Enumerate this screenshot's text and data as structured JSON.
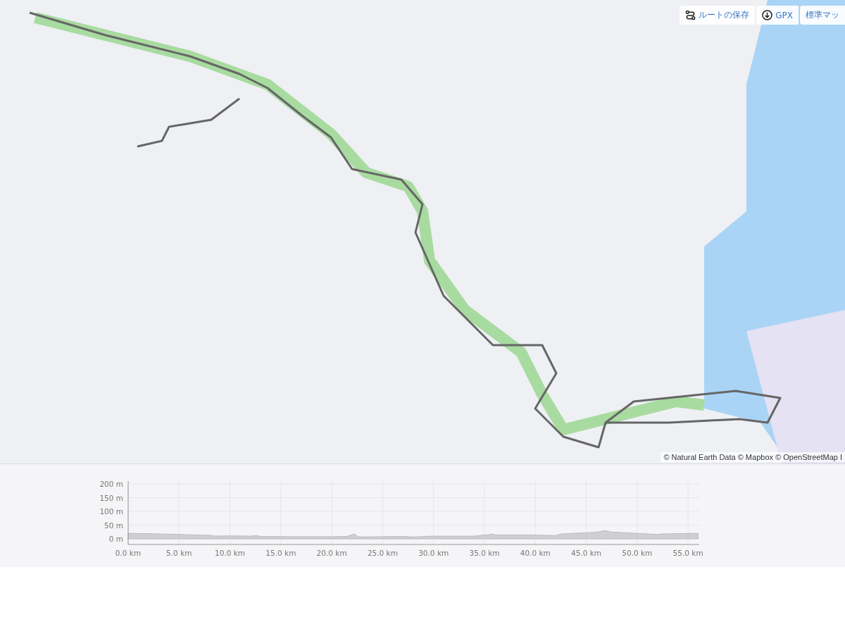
{
  "map": {
    "buttons": [
      {
        "kind": "route",
        "label": "ルートの保存"
      },
      {
        "kind": "download",
        "label": "GPX"
      },
      {
        "kind": "plain",
        "label": "標準マッ"
      }
    ],
    "attribution": "© Natural Earth Data © Mapbox © OpenStreetMap I"
  },
  "elevation": {
    "chart_data": {
      "type": "area",
      "x": [
        0,
        2,
        4,
        6,
        8,
        8.5,
        10,
        12,
        12.6,
        13,
        16,
        20,
        21.5,
        22.2,
        22.6,
        25,
        27,
        28,
        30,
        34,
        35.3,
        35.9,
        36,
        40,
        42,
        42.5,
        46,
        46.8,
        47.5,
        50,
        52,
        52.5,
        54,
        56
      ],
      "series": [
        {
          "color": "#cfcfd2",
          "values": [
            20,
            19,
            17,
            15,
            13,
            10,
            11,
            10,
            12,
            9,
            8,
            8,
            9,
            18,
            7,
            8,
            9,
            7,
            10,
            10,
            15,
            18,
            14,
            14,
            12,
            18,
            24,
            30,
            25,
            20,
            16,
            18,
            19,
            20
          ]
        }
      ],
      "ylim": [
        0,
        210
      ],
      "grid": true,
      "xlim": [
        0,
        56.1
      ],
      "xticks": [
        {
          "value": 0,
          "label": "0.0 km"
        },
        {
          "value": 5,
          "label": "5.0 km"
        },
        {
          "value": 10,
          "label": "10.0 km"
        },
        {
          "value": 15,
          "label": "15.0 km"
        },
        {
          "value": 20,
          "label": "20.0 km"
        },
        {
          "value": 25,
          "label": "25.0 km"
        },
        {
          "value": 30,
          "label": "30.0 km"
        },
        {
          "value": 35,
          "label": "35.0 km"
        },
        {
          "value": 40,
          "label": "40.0 km"
        },
        {
          "value": 45,
          "label": "45.0 km"
        },
        {
          "value": 50,
          "label": "50.0 km"
        },
        {
          "value": 55,
          "label": "55.0 km"
        }
      ],
      "yticks": [
        {
          "value": 0,
          "label": "0 m"
        },
        {
          "value": 50,
          "label": "50 m"
        },
        {
          "value": 100,
          "label": "100 m"
        },
        {
          "value": 150,
          "label": "150 m"
        },
        {
          "value": 200,
          "label": "200 m"
        }
      ]
    }
  }
}
